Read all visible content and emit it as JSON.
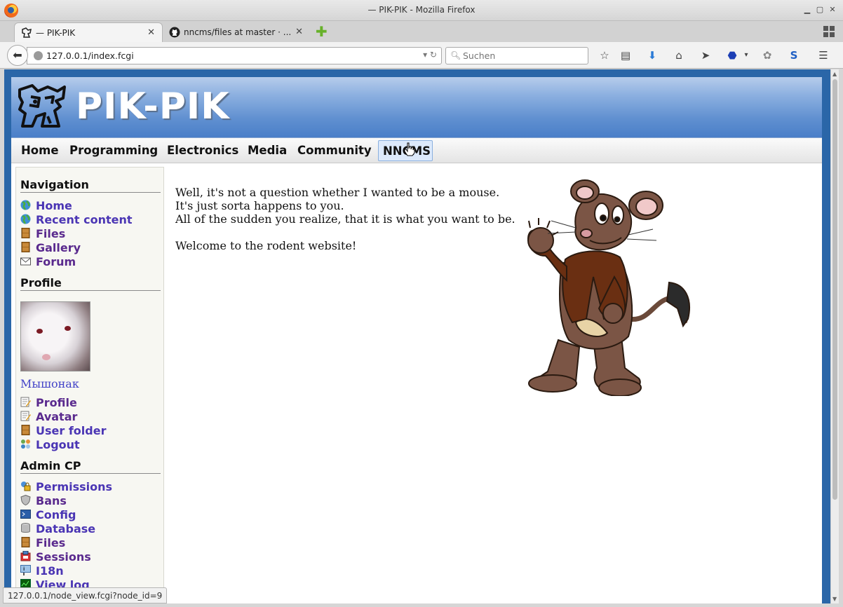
{
  "window": {
    "title": "— PIK-PIK - Mozilla Firefox"
  },
  "tabs": [
    {
      "label": "— PIK-PIK",
      "active": true
    },
    {
      "label": "nncms/files at master · ...",
      "active": false
    }
  ],
  "navbar": {
    "url": "127.0.0.1/index.fcgi",
    "search_placeholder": "Suchen",
    "icons": [
      "bookmark-star-icon",
      "reading-list-icon",
      "downloads-icon",
      "home-icon",
      "send-icon",
      "adblock-icon",
      "addon-icon",
      "skype-icon",
      "menu-icon"
    ]
  },
  "site": {
    "title": "PIK-PIK",
    "menu": [
      "Home",
      "Programming",
      "Electronics",
      "Media",
      "Community",
      "NNCMS"
    ],
    "active_menu": "NNCMS"
  },
  "sidebar": {
    "navigation": {
      "heading": "Navigation",
      "items": [
        {
          "label": "Home",
          "icon": "globe-icon"
        },
        {
          "label": "Recent content",
          "icon": "globe-icon"
        },
        {
          "label": "Files",
          "icon": "cabinet-icon"
        },
        {
          "label": "Gallery",
          "icon": "cabinet-icon"
        },
        {
          "label": "Forum",
          "icon": "envelope-icon"
        }
      ]
    },
    "profile": {
      "heading": "Profile",
      "username": "Мышонак",
      "items": [
        {
          "label": "Profile",
          "icon": "edit-icon"
        },
        {
          "label": "Avatar",
          "icon": "edit-icon"
        },
        {
          "label": "User folder",
          "icon": "cabinet-icon"
        },
        {
          "label": "Logout",
          "icon": "users-icon"
        }
      ]
    },
    "admin": {
      "heading": "Admin CP",
      "items": [
        {
          "label": "Permissions",
          "icon": "lock-icon"
        },
        {
          "label": "Bans",
          "icon": "shield-icon"
        },
        {
          "label": "Config",
          "icon": "terminal-icon"
        },
        {
          "label": "Database",
          "icon": "database-icon"
        },
        {
          "label": "Files",
          "icon": "cabinet-icon"
        },
        {
          "label": "Sessions",
          "icon": "sessions-icon"
        },
        {
          "label": "I18n",
          "icon": "flag-icon"
        },
        {
          "label": "View log",
          "icon": "log-icon"
        }
      ]
    }
  },
  "main": {
    "lines": [
      "Well, it's not a question whether I wanted to be a mouse.",
      "It's just sorta happens to you.",
      "All of the sudden you realize, that it is what you want to be.",
      "",
      "Welcome to the rodent website!"
    ]
  },
  "statusbar": {
    "text": "127.0.0.1/node_view.fcgi?node_id=9"
  },
  "colors": {
    "banner": "#5f8fd0",
    "link": "#4a35b4",
    "visited": "#5a2a8e",
    "menu_active_bg": "#dce9fb"
  }
}
